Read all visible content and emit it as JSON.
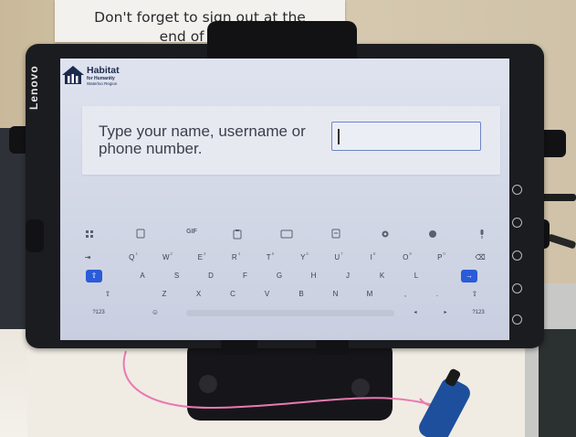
{
  "notice": {
    "line1": "Don't forget to sign out at the",
    "line2": "end of your"
  },
  "device": {
    "brand": "Lenovo"
  },
  "logo": {
    "name": "Habitat",
    "sub": "for Humanity",
    "region": "Waterloo Region"
  },
  "prompt": {
    "text": "Type your name, username or phone number.",
    "input_value": "",
    "input_placeholder": ""
  },
  "keyboard": {
    "toolbar": [
      "grid-icon",
      "sticker-icon",
      "GIF",
      "clipboard-icon",
      "keyboard-icon",
      "emoji-panel-icon",
      "gear-icon",
      "palette-icon",
      "mic-icon"
    ],
    "toolbar_gif": "GIF",
    "row1": [
      {
        "label": "Q",
        "sup": "1"
      },
      {
        "label": "W",
        "sup": "2"
      },
      {
        "label": "E",
        "sup": "3"
      },
      {
        "label": "R",
        "sup": "4"
      },
      {
        "label": "T",
        "sup": "5"
      },
      {
        "label": "Y",
        "sup": "6"
      },
      {
        "label": "U",
        "sup": "7"
      },
      {
        "label": "I",
        "sup": "8"
      },
      {
        "label": "O",
        "sup": "9"
      },
      {
        "label": "P",
        "sup": "0"
      }
    ],
    "row2": [
      "A",
      "S",
      "D",
      "F",
      "G",
      "H",
      "J",
      "K",
      "L"
    ],
    "row3": [
      "Z",
      "X",
      "C",
      "V",
      "B",
      "N",
      "M"
    ],
    "row3_extra": [
      ",",
      "."
    ],
    "tab_label": "⇥",
    "backspace_label": "⌫",
    "shift_label": "⇧",
    "numbers_label": "?123",
    "numbers_label_right": "?123",
    "emoji_label": "☺",
    "left_arrow": "◂",
    "right_arrow": "▸",
    "enter_label": "→",
    "caps_label": "⇧",
    "accent_color": "#2a5bd8"
  },
  "colors": {
    "screen_bg": "#d2d7e6",
    "input_border": "#6b86c8"
  }
}
